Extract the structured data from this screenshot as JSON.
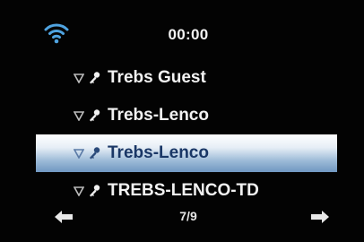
{
  "status_bar": {
    "time": "00:00",
    "wifi_icon": "wifi-icon"
  },
  "networks": [
    {
      "name": "Trebs Guest",
      "selected": false,
      "secured": true
    },
    {
      "name": "Trebs-Lenco",
      "selected": false,
      "secured": true
    },
    {
      "name": "Trebs-Lenco",
      "selected": true,
      "secured": true
    },
    {
      "name": "TREBS-LENCO-TD",
      "selected": false,
      "secured": true
    }
  ],
  "footer": {
    "page_indicator": "7/9",
    "prev_icon": "arrow-left-icon",
    "next_icon": "arrow-right-icon"
  },
  "colors": {
    "background": "#030303",
    "text": "#f2f2f2",
    "wifi_blue": "#4fa3e0",
    "selection_top": "#ffffff",
    "selection_bottom": "#7097c1",
    "selection_text": "#1a3766"
  }
}
